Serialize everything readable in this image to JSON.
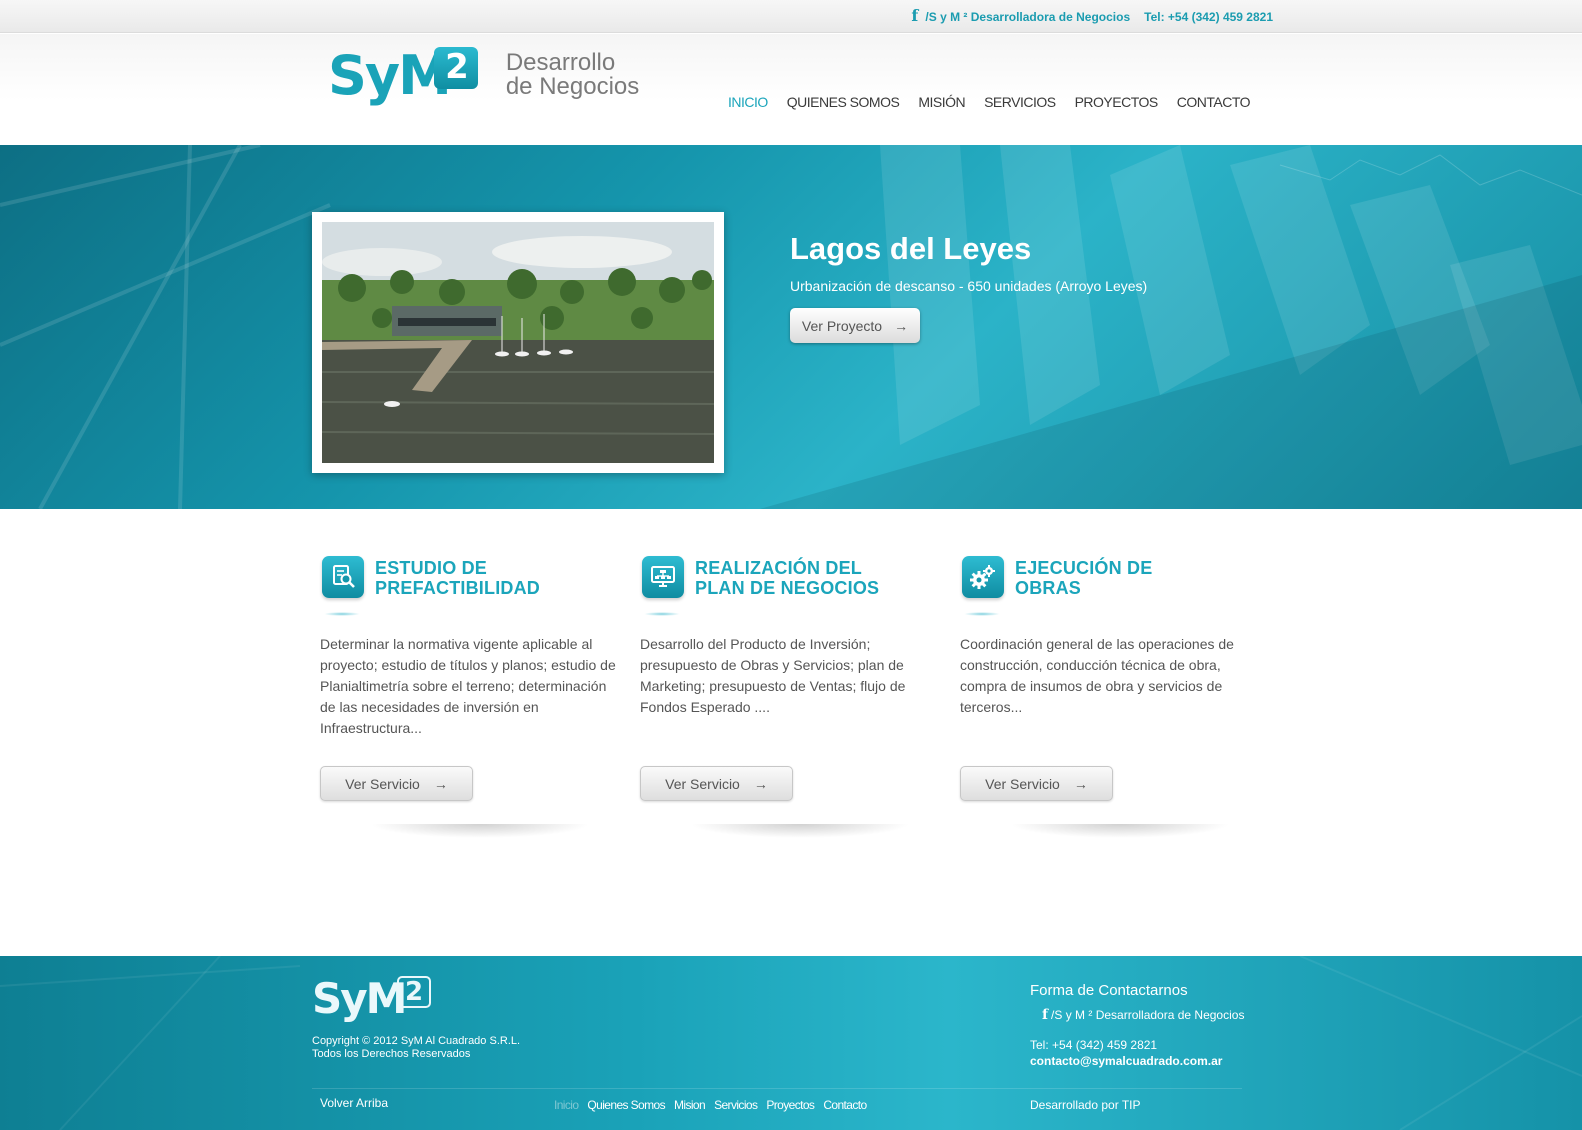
{
  "topbar": {
    "facebook_text": "/S y M ² Desarrolladora de Negocios",
    "phone": "Tel: +54 (342) 459 2821"
  },
  "logo": {
    "sym": "SyM",
    "sup": "2",
    "line1": "Desarrollo",
    "line2": "de Negocios"
  },
  "nav": [
    {
      "label": "INICIO",
      "active": true
    },
    {
      "label": "QUIENES SOMOS",
      "active": false
    },
    {
      "label": "MISIÓN",
      "active": false
    },
    {
      "label": "SERVICIOS",
      "active": false
    },
    {
      "label": "PROYECTOS",
      "active": false
    },
    {
      "label": "CONTACTO",
      "active": false
    }
  ],
  "hero": {
    "title": "Lagos del Leyes",
    "subtitle": "Urbanización de descanso - 650 unidades (Arroyo Leyes)",
    "button_label": "Ver Proyecto",
    "button_arrow": "→"
  },
  "services": [
    {
      "icon": "magnifier-document-icon",
      "title_line1": "ESTUDIO DE",
      "title_line2": "PREFACTIBILIDAD",
      "description": "Determinar la normativa vigente aplicable al proyecto; estudio de títulos y planos; estudio de Planialtimetría sobre el terreno; determinación de las necesidades de inversión en Infraestructura...",
      "button_label": "Ver Servicio",
      "button_arrow": "→"
    },
    {
      "icon": "monitor-network-icon",
      "title_line1": "REALIZACIÓN DEL",
      "title_line2": "PLAN DE NEGOCIOS",
      "description": "Desarrollo del Producto de Inversión; presupuesto de Obras y Servicios; plan de Marketing; presupuesto de Ventas; flujo de Fondos Esperado ....",
      "button_label": "Ver Servicio",
      "button_arrow": "→"
    },
    {
      "icon": "gears-icon",
      "title_line1": "EJECUCIÓN DE",
      "title_line2": "OBRAS",
      "description": "Coordinación general de las operaciones de construcción, conducción técnica de obra, compra de insumos de obra y servicios de terceros...",
      "button_label": "Ver Servicio",
      "button_arrow": "→"
    }
  ],
  "footer": {
    "logo_sym": "SyM",
    "logo_sup": "2",
    "copyright_line1": "Copyright © 2012 SyM Al Cuadrado S.R.L.",
    "copyright_line2": "Todos los Derechos Reservados",
    "back_to_top": "Volver Arriba",
    "nav": [
      "Inicio",
      "Quienes Somos",
      "Mision",
      "Servicios",
      "Proyectos",
      "Contacto"
    ],
    "contact_title": "Forma de Contactarnos",
    "facebook_text": "/S y M ² Desarrolladora de Negocios",
    "phone": "Tel: +54 (342) 459 2821",
    "email": "contacto@symalcuadrado.com.ar",
    "developer": "Desarrollado por TIP"
  },
  "colors": {
    "accent": "#1ba5bb",
    "hero_bg": "#1595ac",
    "footer_bg": "#1aa2b8"
  }
}
